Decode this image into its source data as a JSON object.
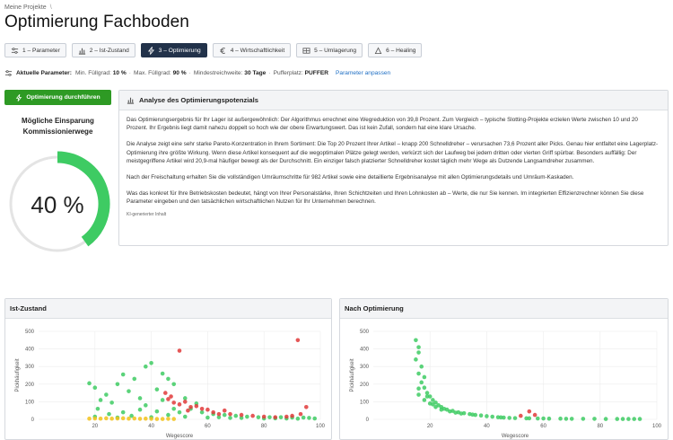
{
  "breadcrumb": {
    "root": "Meine Projekte",
    "sep": "\\"
  },
  "page": {
    "title": "Optimierung Fachboden"
  },
  "tabs": [
    {
      "label": "1 – Parameter",
      "icon": "sliders-icon",
      "active": false
    },
    {
      "label": "2 – Ist-Zustand",
      "icon": "chart-icon",
      "active": false
    },
    {
      "label": "3 – Optimierung",
      "icon": "zap-icon",
      "active": true
    },
    {
      "label": "4 – Wirtschaftlichkeit",
      "icon": "euro-icon",
      "active": false
    },
    {
      "label": "5 – Umlagerung",
      "icon": "shelf-icon",
      "active": false
    },
    {
      "label": "6 – Healing",
      "icon": "bandage-icon",
      "active": false
    }
  ],
  "params": {
    "label": "Aktuelle Parameter:",
    "min_label": "Min. Füllgrad:",
    "min_value": "10 %",
    "max_label": "Max. Füllgrad:",
    "max_value": "90 %",
    "reach_label": "Mindestreichweite:",
    "reach_value": "30 Tage",
    "buffer_label": "Pufferplatz:",
    "buffer_value": "PUFFER",
    "adjust_link": "Parameter anpassen"
  },
  "run_button": "Optimierung durchführen",
  "gauge": {
    "title_line1": "Mögliche Einsparung",
    "title_line2": "Kommissionierwege",
    "value_text": "40 %",
    "fraction": 0.4,
    "color": "#3ecb63",
    "track": "#e4e4e4"
  },
  "analysis": {
    "title": "Analyse des Optimierungspotenzials",
    "p1": "Das Optimierungsergebnis für Ihr Lager ist außergewöhnlich: Der Algorithmus errechnet eine Wegreduktion von 39,8 Prozent. Zum Vergleich – typische Slotting-Projekte erzielen Werte zwischen 10 und 20 Prozent. Ihr Ergebnis liegt damit nahezu doppelt so hoch wie der obere Erwartungswert. Das ist kein Zufall, sondern hat eine klare Ursache.",
    "p2": "Die Analyse zeigt eine sehr starke Pareto-Konzentration in Ihrem Sortiment: Die Top 20 Prozent Ihrer Artikel – knapp 200 Schnelldreher – verursachen 73,6 Prozent aller Picks. Genau hier entfaltet eine Lagerplatz-Optimierung ihre größte Wirkung. Wenn diese Artikel konsequent auf die wegoptimalen Plätze gelegt werden, verkürzt sich der Laufweg bei jedem dritten oder vierten Griff spürbar. Besonders auffällig: Der meistgegriffene Artikel wird 20,9-mal häufiger bewegt als der Durchschnitt. Ein einziger falsch platzierter Schnelldreher kostet täglich mehr Wege als Dutzende Langsamdreher zusammen.",
    "p3": "Nach der Freischaltung erhalten Sie die vollständigen Umräumschritte für 982 Artikel sowie eine detaillierte Ergebnisanalyse mit allen Optimierungsdetails und Umräum-Kaskaden.",
    "p4": "Was das konkret für Ihre Betriebskosten bedeutet, hängt von Ihrer Personalstärke, Ihren Schichtzeiten und Ihren Lohnkosten ab – Werte, die nur Sie kennen. Im integrierten Effizienzrechner können Sie diese Parameter eingeben und den tatsächlichen wirtschaftlichen Nutzen für Ihr Unternehmen berechnen.",
    "ai_note": "KI-generierter Inhalt"
  },
  "panels": {
    "ist": {
      "title": "Ist-Zustand"
    },
    "nach": {
      "title": "Nach Optimierung"
    }
  },
  "colors": {
    "green": "#3ecb63",
    "red": "#e03a3a",
    "yellow": "#f2c21b",
    "active_tab": "#22324a",
    "run_button": "#2e9a24"
  },
  "chart_data": [
    {
      "type": "scatter",
      "title": "Ist-Zustand",
      "xlabel": "Wegescore",
      "ylabel": "Pickhäufigkeit",
      "xlim": [
        0,
        100
      ],
      "ylim": [
        0,
        500
      ],
      "xticks": [
        20,
        40,
        60,
        80,
        100
      ],
      "yticks": [
        0,
        100,
        200,
        300,
        400,
        500
      ],
      "grid": true,
      "series": [
        {
          "color": "#3ecb63",
          "points": [
            [
              18,
              205
            ],
            [
              20,
              180
            ],
            [
              22,
              110
            ],
            [
              21,
              60
            ],
            [
              24,
              140
            ],
            [
              26,
              95
            ],
            [
              28,
              200
            ],
            [
              30,
              255
            ],
            [
              32,
              160
            ],
            [
              34,
              230
            ],
            [
              36,
              120
            ],
            [
              38,
              300
            ],
            [
              40,
              320
            ],
            [
              42,
              170
            ],
            [
              44,
              260
            ],
            [
              46,
              230
            ],
            [
              48,
              200
            ],
            [
              38,
              80
            ],
            [
              44,
              110
            ],
            [
              52,
              120
            ],
            [
              48,
              60
            ],
            [
              56,
              90
            ],
            [
              42,
              45
            ],
            [
              30,
              40
            ],
            [
              36,
              55
            ],
            [
              50,
              40
            ],
            [
              54,
              60
            ],
            [
              58,
              40
            ],
            [
              62,
              30
            ],
            [
              66,
              25
            ],
            [
              70,
              20
            ],
            [
              74,
              15
            ],
            [
              78,
              12
            ],
            [
              82,
              12
            ],
            [
              86,
              12
            ],
            [
              90,
              10
            ],
            [
              94,
              10
            ],
            [
              96,
              8
            ],
            [
              25,
              30
            ],
            [
              33,
              20
            ],
            [
              46,
              25
            ],
            [
              60,
              10
            ],
            [
              68,
              8
            ],
            [
              80,
              5
            ],
            [
              88,
              5
            ],
            [
              92,
              4
            ],
            [
              20,
              15
            ],
            [
              28,
              10
            ],
            [
              40,
              12
            ],
            [
              52,
              15
            ],
            [
              64,
              12
            ],
            [
              72,
              8
            ],
            [
              84,
              6
            ],
            [
              98,
              5
            ]
          ]
        },
        {
          "color": "#e03a3a",
          "points": [
            [
              50,
              390
            ],
            [
              92,
              450
            ],
            [
              46,
              115
            ],
            [
              48,
              95
            ],
            [
              50,
              85
            ],
            [
              52,
              100
            ],
            [
              54,
              70
            ],
            [
              56,
              75
            ],
            [
              58,
              60
            ],
            [
              60,
              55
            ],
            [
              62,
              40
            ],
            [
              64,
              30
            ],
            [
              66,
              50
            ],
            [
              68,
              30
            ],
            [
              72,
              25
            ],
            [
              76,
              20
            ],
            [
              80,
              15
            ],
            [
              84,
              12
            ],
            [
              88,
              15
            ],
            [
              90,
              20
            ],
            [
              95,
              70
            ],
            [
              93,
              30
            ],
            [
              45,
              150
            ],
            [
              47,
              130
            ],
            [
              53,
              50
            ]
          ]
        },
        {
          "color": "#f2c21b",
          "points": [
            [
              18,
              4
            ],
            [
              20,
              5
            ],
            [
              22,
              4
            ],
            [
              24,
              6
            ],
            [
              26,
              4
            ],
            [
              28,
              5
            ],
            [
              30,
              6
            ],
            [
              32,
              4
            ],
            [
              34,
              5
            ],
            [
              36,
              3
            ],
            [
              38,
              4
            ],
            [
              40,
              3
            ],
            [
              42,
              2
            ],
            [
              44,
              2
            ],
            [
              46,
              3
            ],
            [
              48,
              2
            ]
          ]
        }
      ]
    },
    {
      "type": "scatter",
      "title": "Nach Optimierung",
      "xlabel": "Wegescore",
      "ylabel": "Pickhäufigkeit",
      "xlim": [
        0,
        100
      ],
      "ylim": [
        0,
        500
      ],
      "xticks": [
        20,
        40,
        60,
        80,
        100
      ],
      "yticks": [
        0,
        100,
        200,
        300,
        400,
        500
      ],
      "grid": true,
      "series": [
        {
          "color": "#3ecb63",
          "points": [
            [
              15,
              450
            ],
            [
              16,
              410
            ],
            [
              16,
              380
            ],
            [
              15,
              340
            ],
            [
              17,
              300
            ],
            [
              16,
              260
            ],
            [
              18,
              240
            ],
            [
              17,
              210
            ],
            [
              18,
              180
            ],
            [
              19,
              150
            ],
            [
              16,
              140
            ],
            [
              20,
              130
            ],
            [
              21,
              110
            ],
            [
              22,
              95
            ],
            [
              23,
              80
            ],
            [
              24,
              70
            ],
            [
              25,
              60
            ],
            [
              26,
              55
            ],
            [
              28,
              48
            ],
            [
              30,
              40
            ],
            [
              32,
              35
            ],
            [
              34,
              30
            ],
            [
              36,
              25
            ],
            [
              38,
              22
            ],
            [
              40,
              18
            ],
            [
              42,
              15
            ],
            [
              44,
              12
            ],
            [
              46,
              10
            ],
            [
              48,
              8
            ],
            [
              50,
              7
            ],
            [
              54,
              6
            ],
            [
              58,
              5
            ],
            [
              62,
              4
            ],
            [
              66,
              4
            ],
            [
              70,
              3
            ],
            [
              74,
              3
            ],
            [
              78,
              3
            ],
            [
              82,
              2
            ],
            [
              86,
              2
            ],
            [
              88,
              2
            ],
            [
              90,
              2
            ],
            [
              92,
              2
            ],
            [
              94,
              2
            ],
            [
              18,
              110
            ],
            [
              20,
              90
            ],
            [
              22,
              70
            ],
            [
              16,
              175
            ],
            [
              19,
              130
            ],
            [
              21,
              85
            ],
            [
              24,
              55
            ],
            [
              27,
              45
            ],
            [
              29,
              38
            ],
            [
              31,
              33
            ],
            [
              35,
              27
            ],
            [
              45,
              11
            ],
            [
              55,
              6
            ],
            [
              60,
              5
            ],
            [
              68,
              3
            ]
          ]
        },
        {
          "color": "#e03a3a",
          "points": [
            [
              55,
              45
            ],
            [
              52,
              20
            ],
            [
              57,
              25
            ]
          ]
        }
      ]
    }
  ]
}
